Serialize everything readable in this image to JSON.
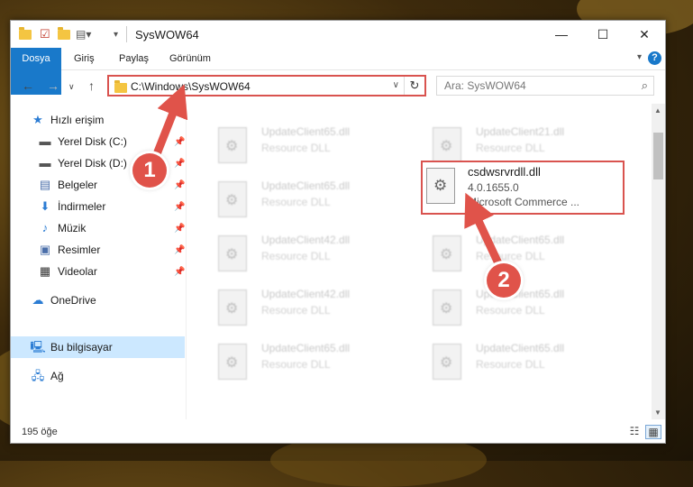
{
  "window": {
    "title": "SysWOW64",
    "controls": [
      "minimize-icon",
      "maximize-icon",
      "close-icon"
    ]
  },
  "ribbon": {
    "tabs": [
      "Dosya",
      "Giriş",
      "Paylaş",
      "Görünüm"
    ],
    "help": "?"
  },
  "address": {
    "path": "C:\\Windows\\SysWOW64",
    "search_placeholder": "Ara: SysWOW64"
  },
  "sidebar": {
    "quick_access": "Hızlı erişim",
    "items": [
      {
        "label": "Yerel Disk (C:)",
        "icon": "drive-icon",
        "pinned": true
      },
      {
        "label": "Yerel Disk (D:)",
        "icon": "drive-icon",
        "pinned": true
      },
      {
        "label": "Belgeler",
        "icon": "documents-icon",
        "pinned": true
      },
      {
        "label": "İndirmeler",
        "icon": "download-icon",
        "pinned": true
      },
      {
        "label": "Müzik",
        "icon": "music-icon",
        "pinned": true
      },
      {
        "label": "Resimler",
        "icon": "pictures-icon",
        "pinned": true
      },
      {
        "label": "Videolar",
        "icon": "video-icon",
        "pinned": true
      }
    ],
    "onedrive": "OneDrive",
    "this_pc": "Bu bilgisayar",
    "network": "Ağ"
  },
  "files": [
    {
      "name": "UpdateClient65.dll",
      "desc": "Resource DLL"
    },
    {
      "name": "UpdateClient21.dll",
      "desc": "Resource DLL"
    },
    {
      "name": "UpdateClient65.dll",
      "desc": "Resource DLL"
    },
    {
      "name": "UpdateClient42.dll",
      "desc": "Resource DLL"
    },
    {
      "name": "UpdateClient65.dll",
      "desc": "Resource DLL"
    },
    {
      "name": "UpdateClient42.dll",
      "desc": "Resource DLL"
    },
    {
      "name": "UpdateClient65.dll",
      "desc": "Resource DLL"
    },
    {
      "name": "UpdateClient65.dll",
      "desc": "Resource DLL"
    },
    {
      "name": "UpdateClient65.dll",
      "desc": "Resource DLL"
    }
  ],
  "highlighted_file": {
    "name": "csdwsrvrdll.dll",
    "version": "4.0.1655.0",
    "company": "Microsoft Commerce ..."
  },
  "status": {
    "count": "195 öğe"
  },
  "callouts": {
    "one": "1",
    "two": "2",
    "color": "#e0534a"
  },
  "colors": {
    "accent": "#1979ca",
    "highlight_border": "#d9534f",
    "selection": "#cce8ff"
  }
}
